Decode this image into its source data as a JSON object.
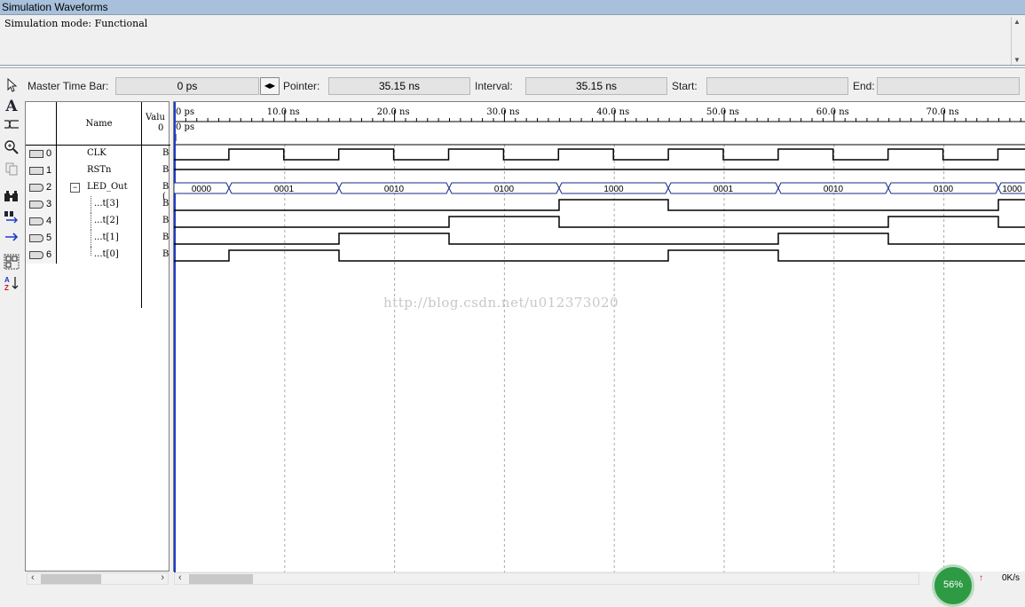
{
  "window": {
    "title": "Simulation Waveforms"
  },
  "mode_text": "Simulation mode: Functional",
  "timebar": {
    "master_label": "Master Time Bar:",
    "master_value": "0 ps",
    "pointer_label": "Pointer:",
    "pointer_value": "35.15 ns",
    "interval_label": "Interval:",
    "interval_value": "35.15 ns",
    "start_label": "Start:",
    "start_value": "",
    "end_label": "End:",
    "end_value": ""
  },
  "columns": {
    "name": "Name",
    "value_line1": "Valu",
    "value_line2": "0"
  },
  "ruler": {
    "labels": [
      "0 ps",
      "10.0 ns",
      "20.0 ns",
      "30.0 ns",
      "40.0 ns",
      "50.0 ns",
      "60.0 ns",
      "70.0 ns"
    ],
    "cursor_label": "0 ps"
  },
  "signals": [
    {
      "index": "0",
      "name": "CLK",
      "value": "B",
      "kind": "input"
    },
    {
      "index": "1",
      "name": "RSTn",
      "value": "B",
      "kind": "input"
    },
    {
      "index": "2",
      "name": "LED_Out",
      "value": "B (",
      "kind": "output"
    },
    {
      "index": "3",
      "name": "...t[3]",
      "value": "B",
      "kind": "output"
    },
    {
      "index": "4",
      "name": "...t[2]",
      "value": "B",
      "kind": "output"
    },
    {
      "index": "5",
      "name": "...t[1]",
      "value": "B",
      "kind": "output"
    },
    {
      "index": "6",
      "name": "...t[0]",
      "value": "B",
      "kind": "output"
    }
  ],
  "bus_values": [
    "0000",
    "0001",
    "0010",
    "0100",
    "1000",
    "0001",
    "0010",
    "0100",
    "1000"
  ],
  "watermark": "http://blog.csdn.net/u012373020",
  "status": {
    "gauge": "56%",
    "speed": "0K/s",
    "speed_arrow": "↑"
  },
  "tools": [
    "pointer-tool",
    "text-tool",
    "waveform-editing-tool",
    "zoom-tool",
    "copy-tool",
    "find-tool",
    "replace-tool",
    "arrow-tool",
    "group-tool",
    "sort-tool"
  ]
}
